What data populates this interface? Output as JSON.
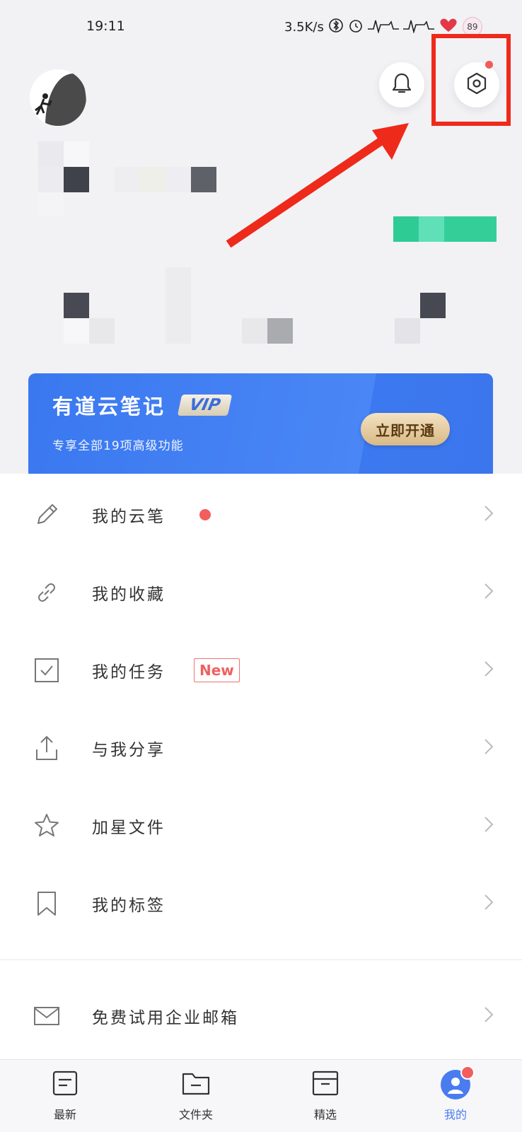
{
  "status_bar": {
    "time": "19:11",
    "speed": "3.5K/s",
    "battery": "89"
  },
  "header": {
    "bell_icon": "bell-icon",
    "settings_icon": "hexagon-settings-icon",
    "settings_has_dot": true
  },
  "vip_banner": {
    "title": "有道云笔记",
    "badge": "VIP",
    "subtitle": "专享全部19项高级功能",
    "button": "立即开通"
  },
  "menu": {
    "items": [
      {
        "label": "我的云笔",
        "icon": "pencil-icon"
      },
      {
        "label": "我的收藏",
        "icon": "link-icon"
      },
      {
        "label": "我的任务",
        "icon": "checkbox-icon",
        "badge": "New"
      },
      {
        "label": "与我分享",
        "icon": "share-icon"
      },
      {
        "label": "加星文件",
        "icon": "star-icon"
      },
      {
        "label": "我的标签",
        "icon": "bookmark-icon"
      }
    ],
    "extra": {
      "label": "免费试用企业邮箱",
      "icon": "mail-icon"
    }
  },
  "tabbar": {
    "tabs": [
      {
        "label": "最新",
        "icon": "note-icon"
      },
      {
        "label": "文件夹",
        "icon": "folder-icon"
      },
      {
        "label": "精选",
        "icon": "inbox-icon"
      },
      {
        "label": "我的",
        "icon": "profile-icon",
        "active": true
      }
    ]
  },
  "colors": {
    "accent": "#3a78f0",
    "highlight": "#ee2a1b",
    "red_dot": "#f25d5d",
    "mosaic_green": "#2ecc95"
  }
}
